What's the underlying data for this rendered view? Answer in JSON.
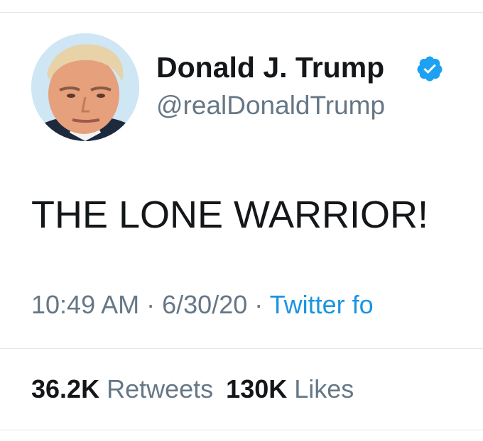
{
  "tweet": {
    "author": {
      "display_name": "Donald J. Trump",
      "handle": "@realDonaldTrump",
      "verified": true
    },
    "text": "THE LONE WARRIOR!",
    "time": "10:49 AM",
    "separator": "·",
    "date": "6/30/20",
    "source": "Twitter fo",
    "stats": {
      "retweets_count": "36.2K",
      "retweets_label": "Retweets",
      "likes_count": "130K",
      "likes_label": "Likes"
    }
  },
  "colors": {
    "text": "#14171a",
    "secondary": "#657786",
    "link": "#1b95e0",
    "verified": "#1da1f2",
    "divider": "#e1e8ed"
  }
}
